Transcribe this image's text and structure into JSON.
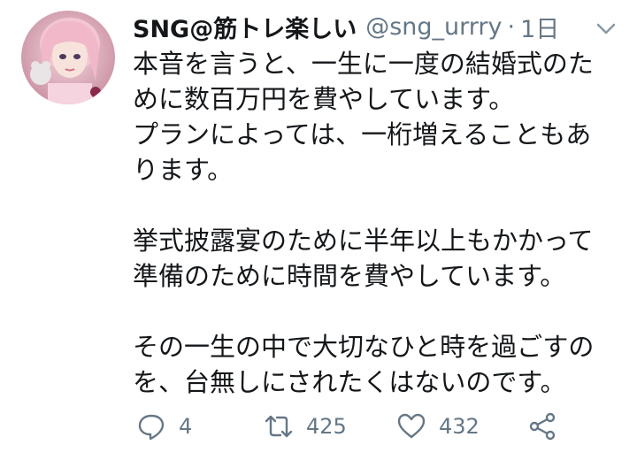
{
  "tweet": {
    "display_name": "SNG@筋トレ楽しい",
    "handle": "@sng_urrry",
    "separator": "·",
    "time": "1日",
    "body_lines": [
      "本音を言うと、一生に一度の結婚式のた",
      "めに数百万円を費やしています。",
      "プランによっては、一桁増えることもあ",
      "ります。",
      "",
      "挙式披露宴のために半年以上もかかって",
      "準備のために時間を費やしています。",
      "",
      "その一生の中で大切なひと時を過ごすの",
      "を、台無しにされたくはないのです。"
    ]
  },
  "actions": {
    "reply_count": "4",
    "retweet_count": "425",
    "like_count": "432"
  },
  "icons": {
    "reply": "reply-icon",
    "retweet": "retweet-icon",
    "like": "heart-icon",
    "share": "share-icon",
    "more": "chevron-down-icon"
  },
  "colors": {
    "text": "#14171a",
    "muted": "#657786",
    "background": "#ffffff"
  }
}
